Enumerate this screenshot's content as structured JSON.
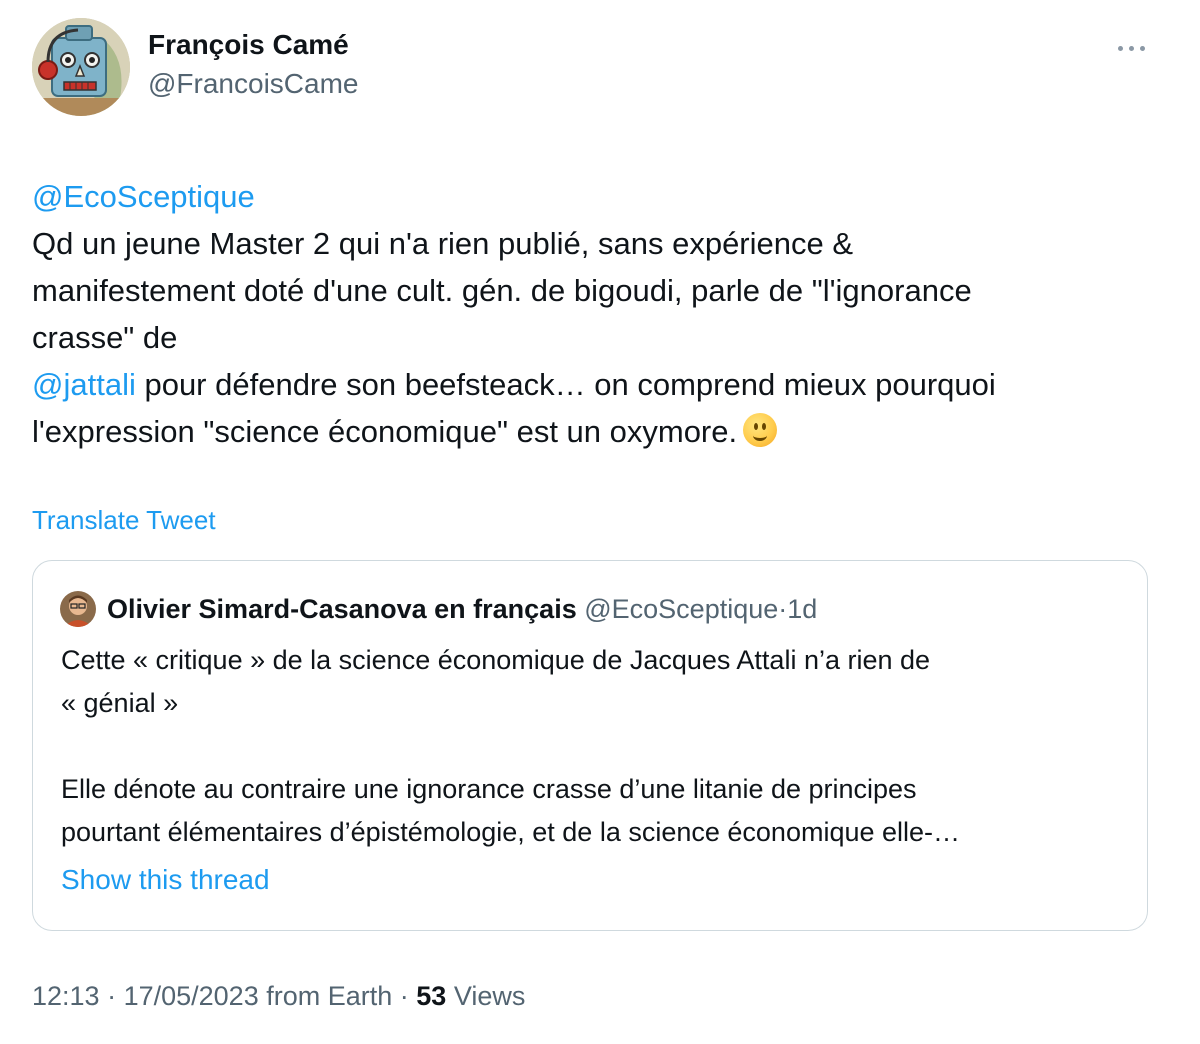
{
  "author": {
    "name": "François Camé",
    "handle": "@FrancoisCame",
    "avatar_icon": "robot-avatar-icon"
  },
  "more_icon": "more-dots-icon",
  "tweet": {
    "mention": "@EcoSceptique",
    "line1": "Qd un jeune Master 2 qui n'a rien publié, sans expérience &",
    "line2": "manifestement doté d'une cult. gén. de bigoudi, parle de \"l'ignorance",
    "line3": "crasse\" de",
    "mention2": "@jattali",
    "line4_rest": " pour défendre son beefsteack… on comprend mieux pourquoi",
    "line5": "l'expression \"science économique\" est un oxymore.",
    "emoji": "slightly-smiling-face-icon"
  },
  "translate_label": "Translate Tweet",
  "quote": {
    "name": "Olivier Simard-Casanova en français",
    "handle": "@EcoSceptique",
    "separator": "·",
    "time": "1d",
    "line1": "Cette « critique » de la science économique de Jacques Attali n’a rien de",
    "line2": "« génial »",
    "line3": "Elle dénote au contraire une ignorance crasse d’une litanie de principes",
    "line4": "pourtant élémentaires d’épistémologie, et de la science économique elle-…",
    "show_thread": "Show this thread"
  },
  "footer": {
    "time": "12:13",
    "sep1": " · ",
    "date": "17/05/2023",
    "source": " from Earth",
    "sep2": " · ",
    "views_count": "53",
    "views_label": " Views"
  },
  "colors": {
    "link": "#1d9bf0",
    "secondary_text": "#536471",
    "border": "#cfd9de"
  }
}
